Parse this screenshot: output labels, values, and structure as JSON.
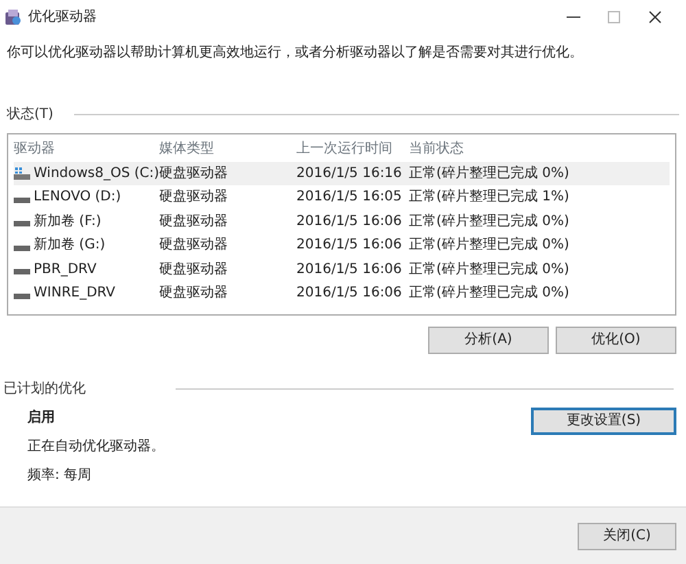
{
  "window": {
    "title": "优化驱动器"
  },
  "description": "你可以优化驱动器以帮助计算机更高效地运行，或者分析驱动器以了解是否需要对其进行优化。",
  "status_section": {
    "title": "状态(T)"
  },
  "table": {
    "columns": [
      "驱动器",
      "媒体类型",
      "上一次运行时间",
      "当前状态"
    ],
    "rows": [
      {
        "kind": "system",
        "drive": "Windows8_OS (C:)",
        "media": "硬盘驱动器",
        "last_run": "2016/1/5 16:16",
        "status": "正常(碎片整理已完成 0%)",
        "selected": true
      },
      {
        "kind": "disk",
        "drive": "LENOVO (D:)",
        "media": "硬盘驱动器",
        "last_run": "2016/1/5 16:05",
        "status": "正常(碎片整理已完成 1%)",
        "selected": false
      },
      {
        "kind": "disk",
        "drive": "新加卷 (F:)",
        "media": "硬盘驱动器",
        "last_run": "2016/1/5 16:06",
        "status": "正常(碎片整理已完成 0%)",
        "selected": false
      },
      {
        "kind": "disk",
        "drive": "新加卷 (G:)",
        "media": "硬盘驱动器",
        "last_run": "2016/1/5 16:06",
        "status": "正常(碎片整理已完成 0%)",
        "selected": false
      },
      {
        "kind": "disk",
        "drive": "PBR_DRV",
        "media": "硬盘驱动器",
        "last_run": "2016/1/5 16:06",
        "status": "正常(碎片整理已完成 0%)",
        "selected": false
      },
      {
        "kind": "disk",
        "drive": "WINRE_DRV",
        "media": "硬盘驱动器",
        "last_run": "2016/1/5 16:06",
        "status": "正常(碎片整理已完成 0%)",
        "selected": false
      }
    ]
  },
  "actions": [
    {
      "label": "分析(A)"
    },
    {
      "label": "优化(O)"
    }
  ],
  "schedule": {
    "title": "已计划的优化",
    "state": "启用",
    "detail": "正在自动优化驱动器。",
    "frequency": "频率: 每周",
    "button": {
      "label": "更改设置(S)",
      "focused": true
    }
  },
  "footer": {
    "button": "关闭(C)"
  }
}
